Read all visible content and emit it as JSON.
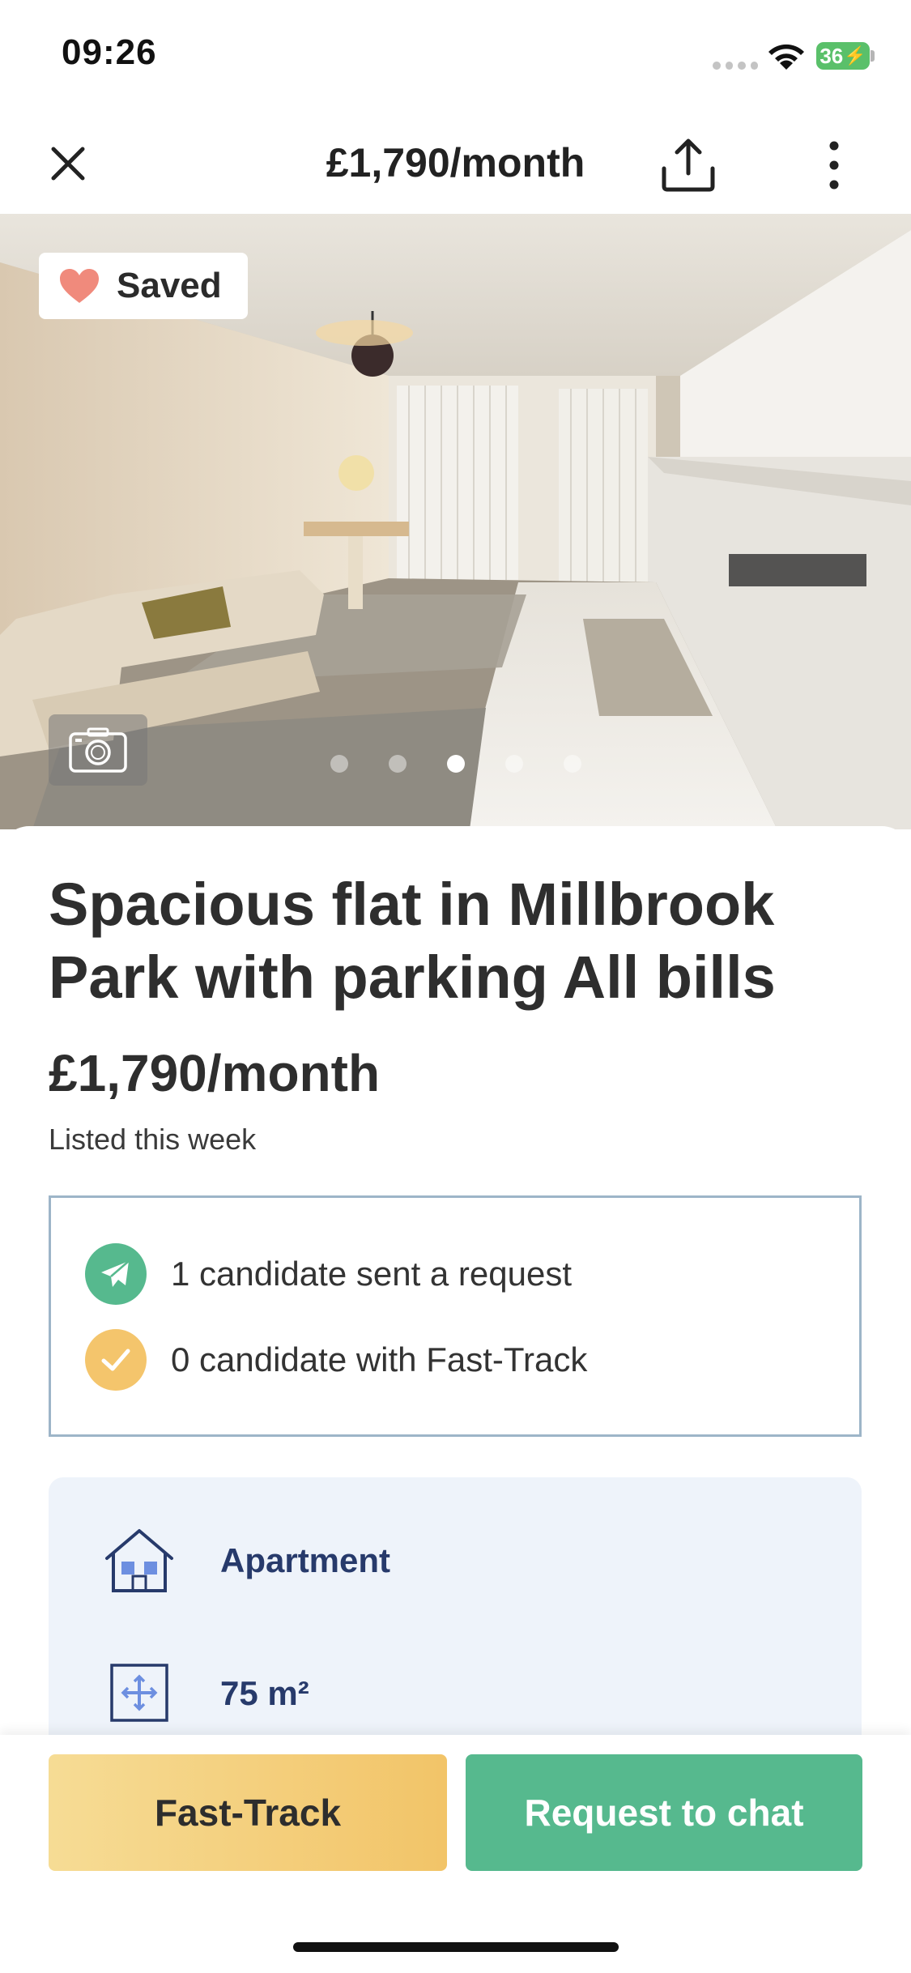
{
  "status_bar": {
    "time": "09:26",
    "battery": "36"
  },
  "nav": {
    "title": "£1,790/month"
  },
  "hero": {
    "saved_label": "Saved",
    "photo_count": 5,
    "active_photo_index": 2
  },
  "listing": {
    "title": "Spacious flat in Millbrook Park with parking All bills",
    "price": "£1,790/month",
    "listed": "Listed this week"
  },
  "stats": {
    "requests": "1 candidate sent a request",
    "fast_track": "0 candidate with Fast-Track"
  },
  "features": {
    "type": "Apartment",
    "size": "75 m²"
  },
  "actions": {
    "fast_track": "Fast-Track",
    "request_chat": "Request to chat"
  },
  "colors": {
    "accent_green": "#56b98e",
    "accent_yellow": "#f2c468",
    "feature_text": "#273a6b",
    "saved_heart": "#f08a7c"
  }
}
